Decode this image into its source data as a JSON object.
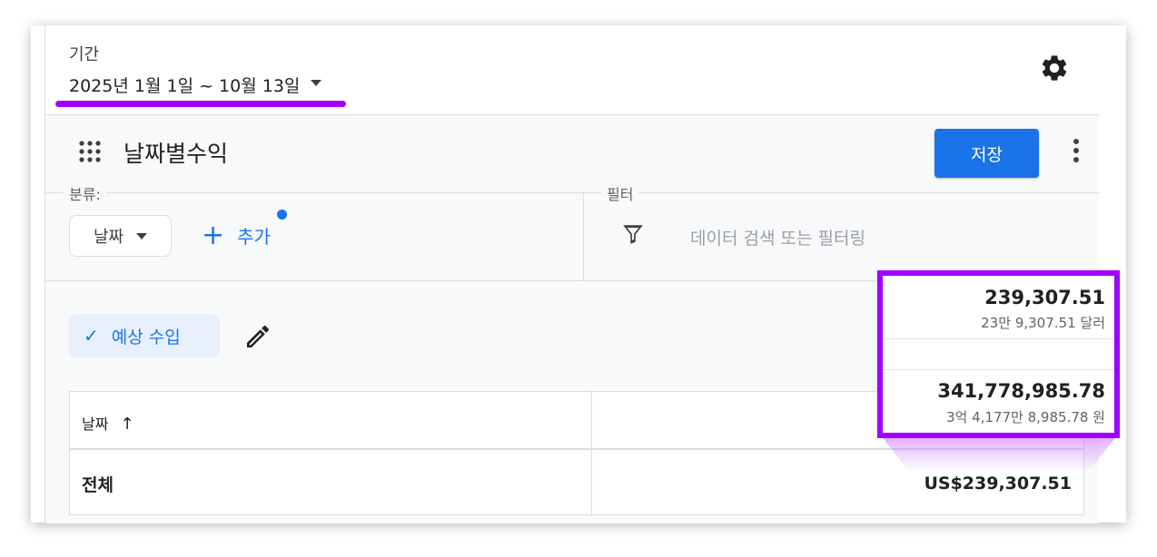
{
  "header": {
    "period_label": "기간",
    "date_range": "2025년 1월 1일 ~ 10월 13일"
  },
  "report": {
    "title": "날짜별수익",
    "save_label": "저장"
  },
  "dimensions": {
    "legend": "분류:",
    "chip_label": "날짜",
    "add_label": "추가"
  },
  "filter": {
    "legend": "필터",
    "placeholder": "데이터 검색 또는 필터링"
  },
  "metric": {
    "label": "예상 수입"
  },
  "table": {
    "header_date": "날짜",
    "total_label": "전체",
    "total_value": "US$239,307.51"
  },
  "popup": {
    "value_usd": "239,307.51",
    "value_usd_sub": "23만 9,307.51 달러",
    "value_krw": "341,778,985.78",
    "value_krw_sub": "3억 4,177만 8,985.78 원"
  },
  "colors": {
    "accent": "#1a73e8",
    "highlight": "#a100ff"
  },
  "icons": [
    "gear-icon",
    "grid-icon",
    "kebab-menu-icon",
    "chevron-down-icon",
    "plus-icon",
    "filter-icon",
    "check-icon",
    "pencil-icon",
    "arrow-up-icon"
  ]
}
